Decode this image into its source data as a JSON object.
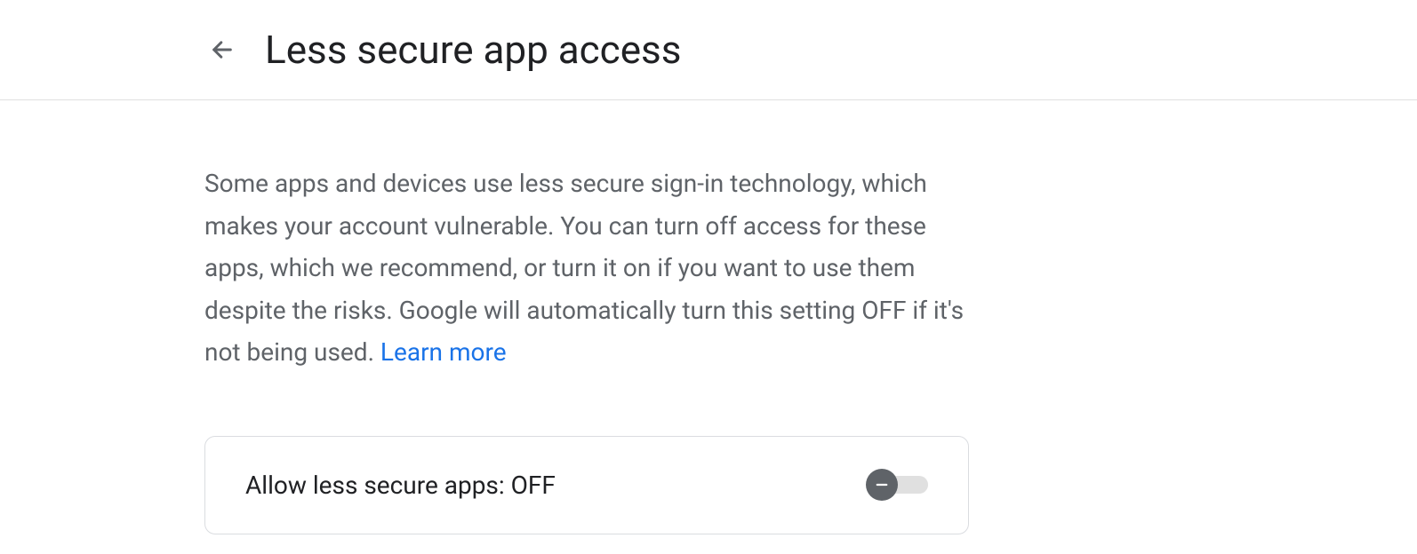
{
  "header": {
    "title": "Less secure app access"
  },
  "description": {
    "text": "Some apps and devices use less secure sign-in technology, which makes your account vulnerable. You can turn off access for these apps, which we recommend, or turn it on if you want to use them despite the risks. Google will automatically turn this setting OFF if it's not being used. ",
    "learn_more": "Learn more"
  },
  "toggle": {
    "label": "Allow less secure apps: OFF",
    "state": "off"
  }
}
